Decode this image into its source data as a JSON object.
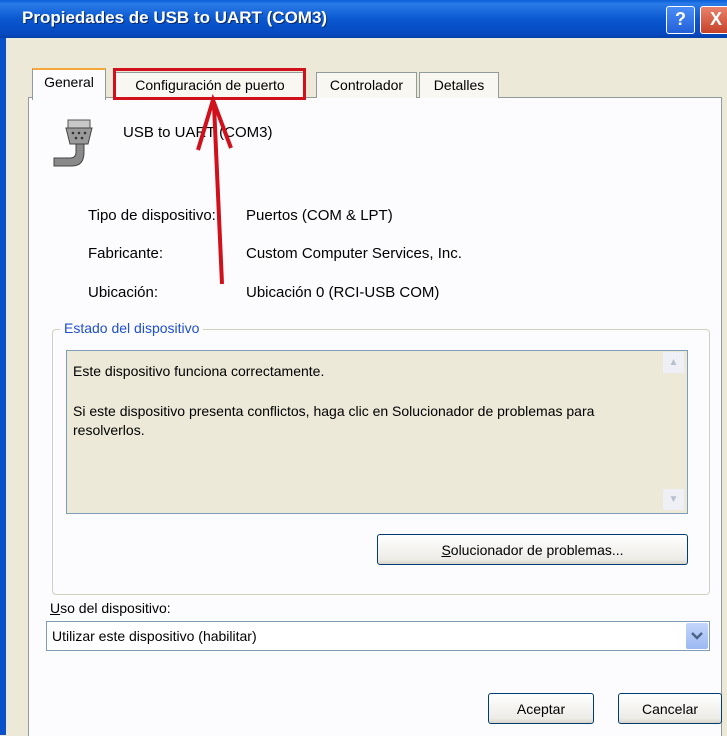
{
  "window": {
    "title": "Propiedades de USB to UART (COM3)",
    "help_glyph": "?",
    "close_glyph": "X"
  },
  "tabs": [
    {
      "label": "General",
      "active": true
    },
    {
      "label": "Configuración de puerto",
      "active": false,
      "highlighted": true
    },
    {
      "label": "Controlador",
      "active": false
    },
    {
      "label": "Detalles",
      "active": false
    }
  ],
  "device": {
    "name": "USB to UART (COM3)",
    "icon": "serial-port-icon"
  },
  "properties": [
    {
      "label": "Tipo de dispositivo:",
      "value": "Puertos (COM & LPT)"
    },
    {
      "label": "Fabricante:",
      "value": "Custom Computer Services, Inc."
    },
    {
      "label": "Ubicación:",
      "value": "Ubicación 0 (RCI-USB COM)"
    }
  ],
  "status_group": {
    "legend": "Estado del dispositivo",
    "line1": "Este dispositivo funciona correctamente.",
    "line2": "Si este dispositivo presenta conflictos, haga clic en Solucionador de problemas para resolverlos.",
    "troubleshoot_button_prefix": "S",
    "troubleshoot_button_rest": "olucionador de problemas..."
  },
  "usage": {
    "label_prefix": "U",
    "label_rest": "so del dispositivo:",
    "selected": "Utilizar este dispositivo (habilitar)"
  },
  "buttons": {
    "ok": "Aceptar",
    "cancel": "Cancelar"
  },
  "colors": {
    "annotation": "#d0101a",
    "titlebar": "#0a58d0"
  }
}
